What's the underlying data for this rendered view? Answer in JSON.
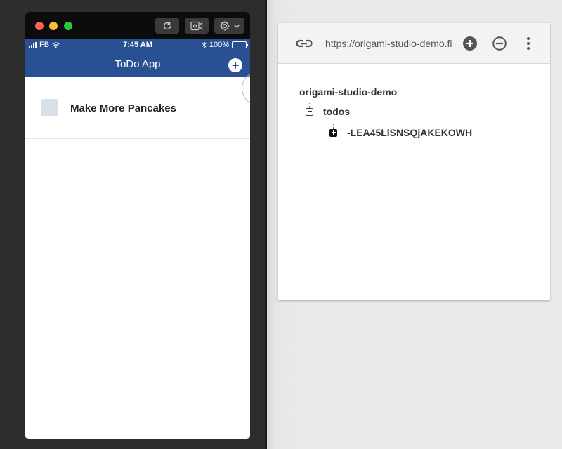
{
  "viewer": {
    "toolbar": {
      "buttons": [
        {
          "icon": "refresh-icon"
        },
        {
          "icon": "record-icon"
        },
        {
          "icon": "gear-icon",
          "has_dropdown": true
        }
      ]
    },
    "status_bar": {
      "carrier": "FB",
      "time": "7:45 AM",
      "battery": "100%",
      "battery_level": 1.0,
      "icons": [
        "signal-icon",
        "wifi-icon",
        "bluetooth-icon",
        "battery-icon"
      ]
    },
    "nav": {
      "title": "ToDo App",
      "add_symbol": "+"
    },
    "todos": [
      {
        "label": "Make More Pancakes",
        "checked": false
      }
    ],
    "colors": {
      "nav_bg": "#2a5094",
      "checkbox": "#d9e0ec"
    }
  },
  "database": {
    "url": "https://origami-studio-demo.firebaseio.com",
    "actions": [
      {
        "icon": "add-circle-icon"
      },
      {
        "icon": "remove-circle-icon"
      },
      {
        "icon": "more-vert-icon"
      }
    ],
    "tree": {
      "root": "origami-studio-demo",
      "child": "todos",
      "grandchild": "-LEA45LlSNSQjAKEKOWH"
    }
  }
}
